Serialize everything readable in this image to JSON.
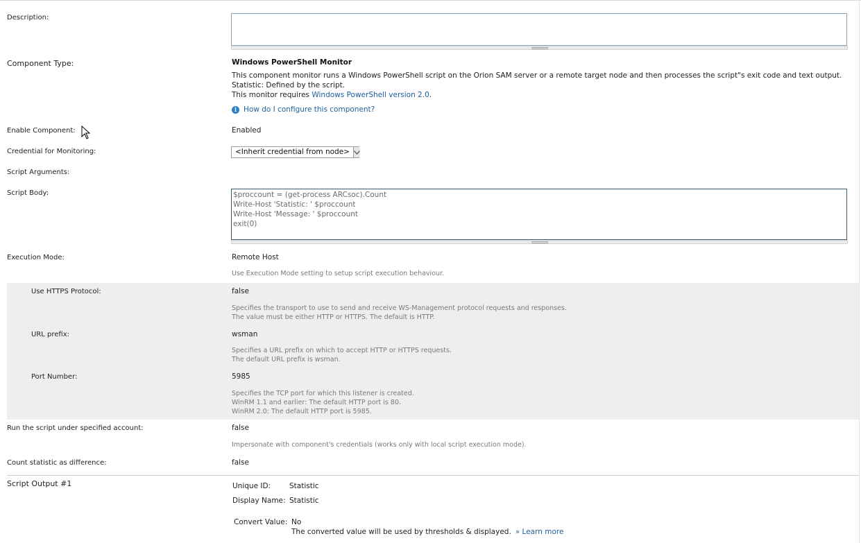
{
  "labels": {
    "description": "Description:",
    "component_type": "Component Type:",
    "enable_component": "Enable Component:",
    "credential": "Credential for Monitoring:",
    "script_arguments": "Script Arguments:",
    "script_body": "Script Body:",
    "execution_mode": "Execution Mode:",
    "use_https": "Use HTTPS Protocol:",
    "url_prefix": "URL prefix:",
    "port_number": "Port Number:",
    "run_under_account": "Run the script under specified account:",
    "count_difference": "Count statistic as difference:",
    "script_output": "Script Output #1"
  },
  "component": {
    "title": "Windows PowerShell Monitor",
    "desc_line1": "This component monitor runs a Windows PowerShell script on the Orion SAM server or a remote target node and then processes the script\"s exit code and text output.",
    "desc_line2": "Statistic: Defined by the script.",
    "requires_prefix": "This monitor requires ",
    "requires_link": "Windows PowerShell version 2.0",
    "requires_suffix": ".",
    "help_link": "How do I configure this component?",
    "info_icon": "i"
  },
  "values": {
    "description": "",
    "enabled": "Enabled",
    "credential_selected": "<Inherit credential from node>",
    "execution_mode": "Remote Host",
    "execution_hint": "Use Execution Mode setting to setup script execution behaviour.",
    "use_https": "false",
    "use_https_hint1": "Specifies the transport to use to send and receive WS-Management protocol requests and responses.",
    "use_https_hint2": "The value must be either HTTP or HTTPS. The default is HTTP.",
    "url_prefix": "wsman",
    "url_prefix_hint1": "Specifies a URL prefix on which to accept HTTP or HTTPS requests.",
    "url_prefix_hint2": "The default URL prefix is wsman.",
    "port_number": "5985",
    "port_hint1": "Specifies the TCP port for which this listener is created.",
    "port_hint2": "WinRM 1.1 and earlier: The default HTTP port is 80.",
    "port_hint3": "WinRM 2.0: The default HTTP port is 5985.",
    "run_under_account": "false",
    "run_under_hint": "Impersonate with component's credentials (works only with local script execution mode).",
    "count_difference": "false"
  },
  "script_body": [
    "$proccount = (get-process ARCsoc).Count",
    "Write-Host 'Statistic: ' $proccount",
    "Write-Host 'Message: ' $proccount",
    "exit(0)"
  ],
  "output": {
    "unique_id_label": "Unique ID:",
    "unique_id": "Statistic",
    "display_name_label": "Display Name:",
    "display_name": "Statistic",
    "convert_label": "Convert Value:",
    "convert_value": "No",
    "convert_note": "The converted value will be used by thresholds & displayed.",
    "learn_more": "» Learn more"
  },
  "colors": {
    "link": "#1a5a9e",
    "hint": "#7a7a7a",
    "grey_section": "#eeeeee"
  }
}
